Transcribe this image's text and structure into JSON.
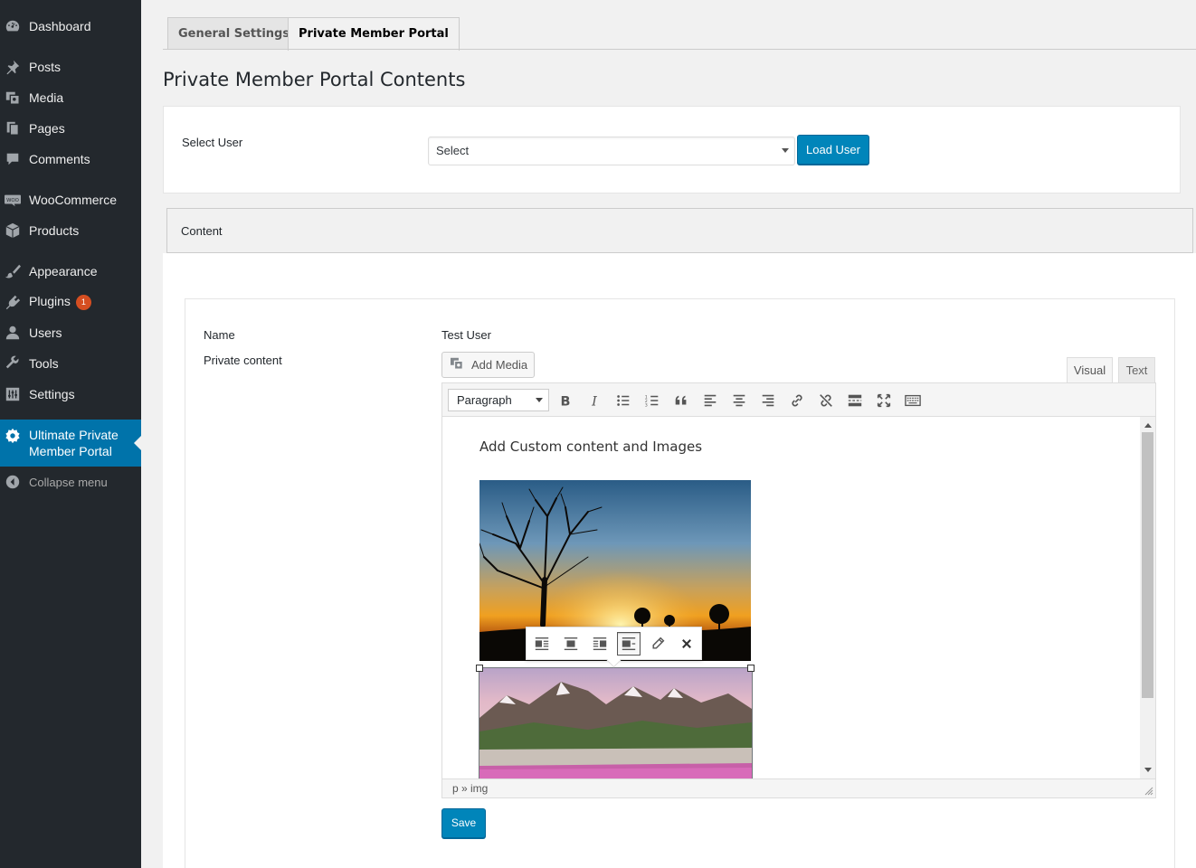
{
  "sidebar": {
    "items": [
      {
        "label": "Dashboard",
        "icon": "dashboard-icon"
      },
      {
        "label": "Posts",
        "icon": "pin-icon"
      },
      {
        "label": "Media",
        "icon": "media-icon"
      },
      {
        "label": "Pages",
        "icon": "pages-icon"
      },
      {
        "label": "Comments",
        "icon": "comment-icon"
      },
      {
        "label": "WooCommerce",
        "icon": "woocommerce-icon"
      },
      {
        "label": "Products",
        "icon": "box-icon"
      },
      {
        "label": "Appearance",
        "icon": "brush-icon"
      },
      {
        "label": "Plugins",
        "icon": "plugin-icon",
        "badge": "1"
      },
      {
        "label": "Users",
        "icon": "user-icon"
      },
      {
        "label": "Tools",
        "icon": "wrench-icon"
      },
      {
        "label": "Settings",
        "icon": "settings-icon"
      },
      {
        "label_line1": "Ultimate Private",
        "label_line2": "Member Portal",
        "icon": "gear-icon",
        "active": true
      }
    ],
    "collapse_label": "Collapse menu"
  },
  "tabs": [
    {
      "label": "General Settings",
      "active": false
    },
    {
      "label": "Private Member Portal",
      "active": true
    }
  ],
  "page_title": "Private Member Portal Contents",
  "select_user": {
    "label": "Select User",
    "selected": "Select",
    "button": "Load User"
  },
  "content_section": {
    "label": "Content"
  },
  "form": {
    "name_label": "Name",
    "name_value": "Test User",
    "private_content_label": "Private content",
    "add_media": "Add Media",
    "editor_tabs": [
      "Visual",
      "Text"
    ],
    "format": "Paragraph",
    "editor_text": "Add Custom content and Images",
    "path": "p » img",
    "save": "Save"
  },
  "colors": {
    "sidebar_bg": "#23282d",
    "accent": "#0073aa",
    "button_primary": "#0085ba",
    "badge": "#d54e21"
  }
}
